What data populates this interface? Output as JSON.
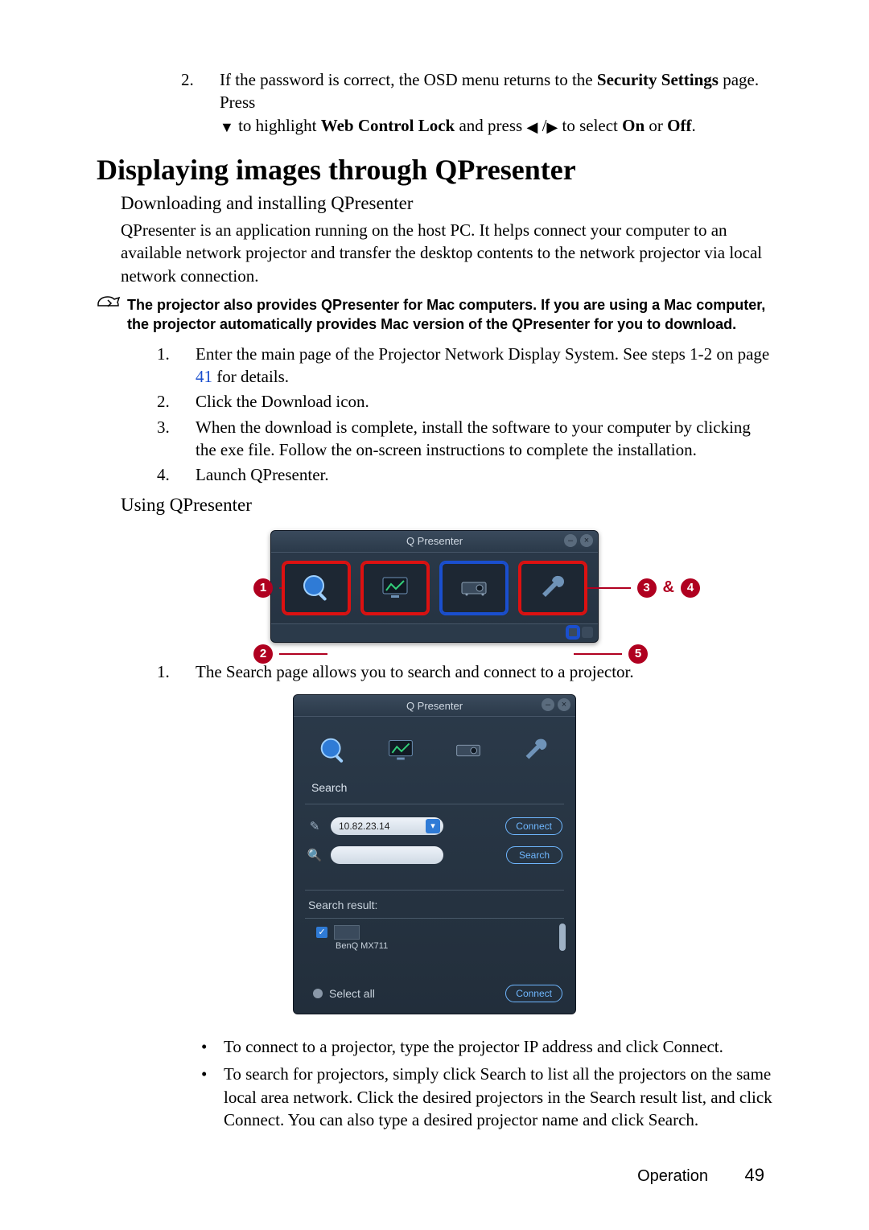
{
  "top_step": {
    "num": "2.",
    "text_a": "If the password is correct, the OSD menu returns to the ",
    "bold_a": "Security Settings",
    "text_b": " page. Press ",
    "text_c": " to highlight ",
    "bold_b": "Web Control Lock",
    "text_d": " and press ",
    "text_e": " to select ",
    "bold_c": "On",
    "text_f": " or ",
    "bold_d": "Off",
    "text_g": "."
  },
  "heading": "Displaying images through QPresenter",
  "sub1": "Downloading and installing QPresenter",
  "intro": "QPresenter is an application running on the host PC. It helps connect your computer to an available network projector and transfer the desktop contents to the network projector via local network connection.",
  "note": "The projector also provides QPresenter for Mac computers. If you are using a Mac computer, the projector automatically provides Mac version of the QPresenter for you to download.",
  "steps": [
    {
      "n": "1.",
      "a": "Enter the main page of the Projector Network Display System. See steps 1-2 on page ",
      "link": "41",
      "b": " for details."
    },
    {
      "n": "2.",
      "a": "Click the Download icon."
    },
    {
      "n": "3.",
      "a": "When the download is complete, install the software to your computer by clicking the exe file. Follow the on-screen instructions to complete the installation."
    },
    {
      "n": "4.",
      "a": "Launch QPresenter."
    }
  ],
  "sub2": "Using QPresenter",
  "fig1": {
    "title": "Q Presenter",
    "callouts": {
      "c1": "1",
      "c2": "2",
      "c3": "3",
      "c4": "4",
      "c5": "5",
      "amp": "&"
    }
  },
  "desc1": {
    "n": "1.",
    "t": "The Search page allows you to search and connect to a projector."
  },
  "fig2": {
    "title": "Q Presenter",
    "searchLabel": "Search",
    "ipValue": "10.82.23.14",
    "connectBtn": "Connect",
    "searchBtn": "Search",
    "resultsHdr": "Search result:",
    "projector": "BenQ MX711",
    "selectAll": "Select all",
    "connectBtn2": "Connect"
  },
  "bullets": [
    "To connect to a projector, type the projector IP address and click Connect.",
    "To search for projectors, simply click Search to list all the projectors on the same local area network. Click the desired projectors in the Search result list, and click Connect. You can also type a desired projector name and click Search."
  ],
  "footer": {
    "section": "Operation",
    "page": "49"
  }
}
